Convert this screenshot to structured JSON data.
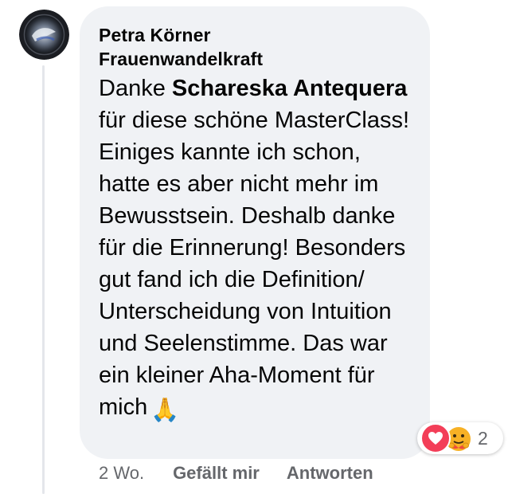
{
  "comment": {
    "author_name": "Petra Körner Frauenwandelkraft",
    "text_before_mention": "Danke ",
    "mention": "Schareska Antequera",
    "text_after_mention": " für diese schöne MasterClass! Einiges kannte ich schon, hatte es aber nicht mehr im Bewusstsein. Deshalb danke für die Erinnerung! Besonders gut fand ich die Definition/ Unterscheidung von Intuition und Seelenstimme. Das war ein kleiner Aha-Moment für mich",
    "emoji": "🙏"
  },
  "reactions": {
    "count": "2",
    "types": [
      "heart-icon",
      "care-icon"
    ]
  },
  "actions": {
    "timestamp": "2 Wo.",
    "like_label": "Gefällt mir",
    "reply_label": "Antworten"
  },
  "colors": {
    "bubble": "#f0f2f5",
    "text": "#050505",
    "meta": "#65676b",
    "heart": "#f33e58"
  }
}
